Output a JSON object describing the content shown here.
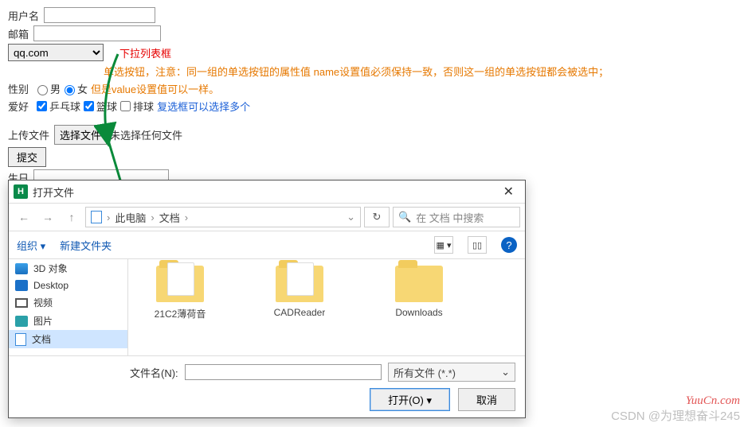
{
  "form": {
    "username_label": "用户名",
    "email_label": "邮箱",
    "email_domain": "qq.com",
    "gender_label": "性别",
    "gender_male": "男",
    "gender_female": "女",
    "hobby_label": "爱好",
    "hobby_pingpong": "乒乓球",
    "hobby_basketball": "篮球",
    "hobby_volleyball": "排球",
    "upload_label": "上传文件",
    "file_btn": "选择文件",
    "file_status": "未选择任何文件",
    "submit": "提交",
    "birthday_label": "生日"
  },
  "notes": {
    "dropdown": "下拉列表框",
    "radio": "单选按钮，注意：同一组的单选按钮的属性值 name设置值必须保持一致，否则这一组的单选按钮都会被选中；",
    "radio2": "但是value设置值可以一样。",
    "checkbox": "复选框可以选择多个"
  },
  "dialog": {
    "title": "打开文件",
    "crumb_pc": "此电脑",
    "crumb_doc": "文档",
    "search_placeholder": "在 文档 中搜索",
    "organize": "组织",
    "newfolder": "新建文件夹",
    "sidebar": [
      {
        "label": "3D 对象"
      },
      {
        "label": "Desktop"
      },
      {
        "label": "视频"
      },
      {
        "label": "图片"
      },
      {
        "label": "文档"
      }
    ],
    "folders": [
      {
        "label": "21C2薄荷音"
      },
      {
        "label": "CADReader"
      },
      {
        "label": "Downloads"
      }
    ],
    "filename_label": "文件名(N):",
    "filter": "所有文件 (*.*)",
    "open_btn": "打开(O)",
    "cancel_btn": "取消"
  },
  "watermark": "YuuCn.com",
  "csdn": "CSDN @为理想奋斗245"
}
